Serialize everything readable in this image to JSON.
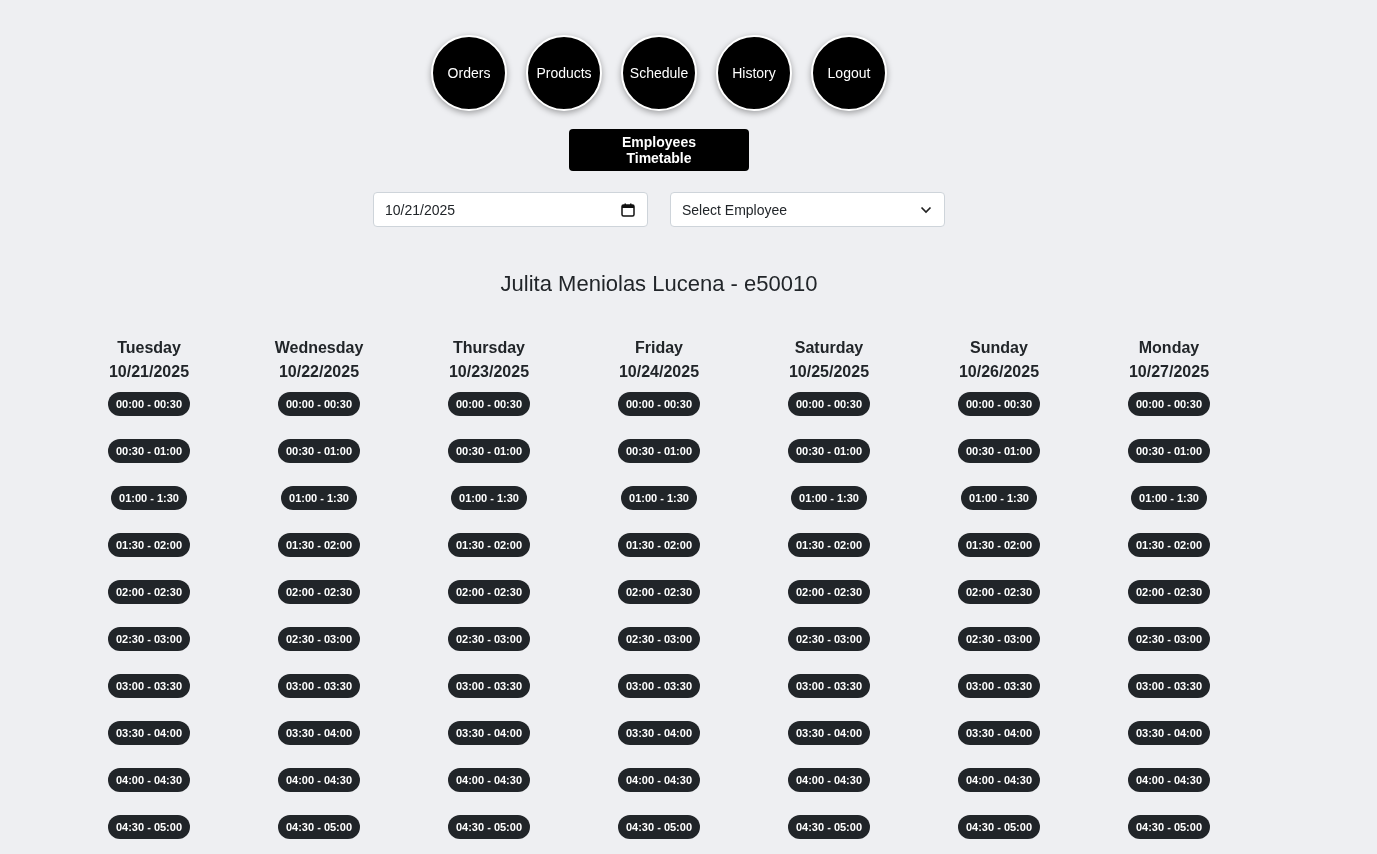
{
  "nav": [
    {
      "label": "Orders"
    },
    {
      "label": "Products"
    },
    {
      "label": "Schedule"
    },
    {
      "label": "History"
    },
    {
      "label": "Logout"
    }
  ],
  "page_title": "Employees Timetable",
  "date_field": {
    "value": "10/21/2025"
  },
  "employee_select": {
    "placeholder": "Select Employee"
  },
  "employee_heading": "Julita Meniolas Lucena - e50010",
  "days": [
    {
      "name": "Tuesday",
      "date": "10/21/2025",
      "slots": [
        "00:00 - 00:30",
        "00:30 - 01:00",
        "01:00 - 1:30",
        "01:30 - 02:00",
        "02:00 - 02:30",
        "02:30 - 03:00",
        "03:00 - 03:30",
        "03:30 - 04:00",
        "04:00 - 04:30",
        "04:30 - 05:00"
      ]
    },
    {
      "name": "Wednesday",
      "date": "10/22/2025",
      "slots": [
        "00:00 - 00:30",
        "00:30 - 01:00",
        "01:00 - 1:30",
        "01:30 - 02:00",
        "02:00 - 02:30",
        "02:30 - 03:00",
        "03:00 - 03:30",
        "03:30 - 04:00",
        "04:00 - 04:30",
        "04:30 - 05:00"
      ]
    },
    {
      "name": "Thursday",
      "date": "10/23/2025",
      "slots": [
        "00:00 - 00:30",
        "00:30 - 01:00",
        "01:00 - 1:30",
        "01:30 - 02:00",
        "02:00 - 02:30",
        "02:30 - 03:00",
        "03:00 - 03:30",
        "03:30 - 04:00",
        "04:00 - 04:30",
        "04:30 - 05:00"
      ]
    },
    {
      "name": "Friday",
      "date": "10/24/2025",
      "slots": [
        "00:00 - 00:30",
        "00:30 - 01:00",
        "01:00 - 1:30",
        "01:30 - 02:00",
        "02:00 - 02:30",
        "02:30 - 03:00",
        "03:00 - 03:30",
        "03:30 - 04:00",
        "04:00 - 04:30",
        "04:30 - 05:00"
      ]
    },
    {
      "name": "Saturday",
      "date": "10/25/2025",
      "slots": [
        "00:00 - 00:30",
        "00:30 - 01:00",
        "01:00 - 1:30",
        "01:30 - 02:00",
        "02:00 - 02:30",
        "02:30 - 03:00",
        "03:00 - 03:30",
        "03:30 - 04:00",
        "04:00 - 04:30",
        "04:30 - 05:00"
      ]
    },
    {
      "name": "Sunday",
      "date": "10/26/2025",
      "slots": [
        "00:00 - 00:30",
        "00:30 - 01:00",
        "01:00 - 1:30",
        "01:30 - 02:00",
        "02:00 - 02:30",
        "02:30 - 03:00",
        "03:00 - 03:30",
        "03:30 - 04:00",
        "04:00 - 04:30",
        "04:30 - 05:00"
      ]
    },
    {
      "name": "Monday",
      "date": "10/27/2025",
      "slots": [
        "00:00 - 00:30",
        "00:30 - 01:00",
        "01:00 - 1:30",
        "01:30 - 02:00",
        "02:00 - 02:30",
        "02:30 - 03:00",
        "03:00 - 03:30",
        "03:30 - 04:00",
        "04:00 - 04:30",
        "04:30 - 05:00"
      ]
    }
  ]
}
